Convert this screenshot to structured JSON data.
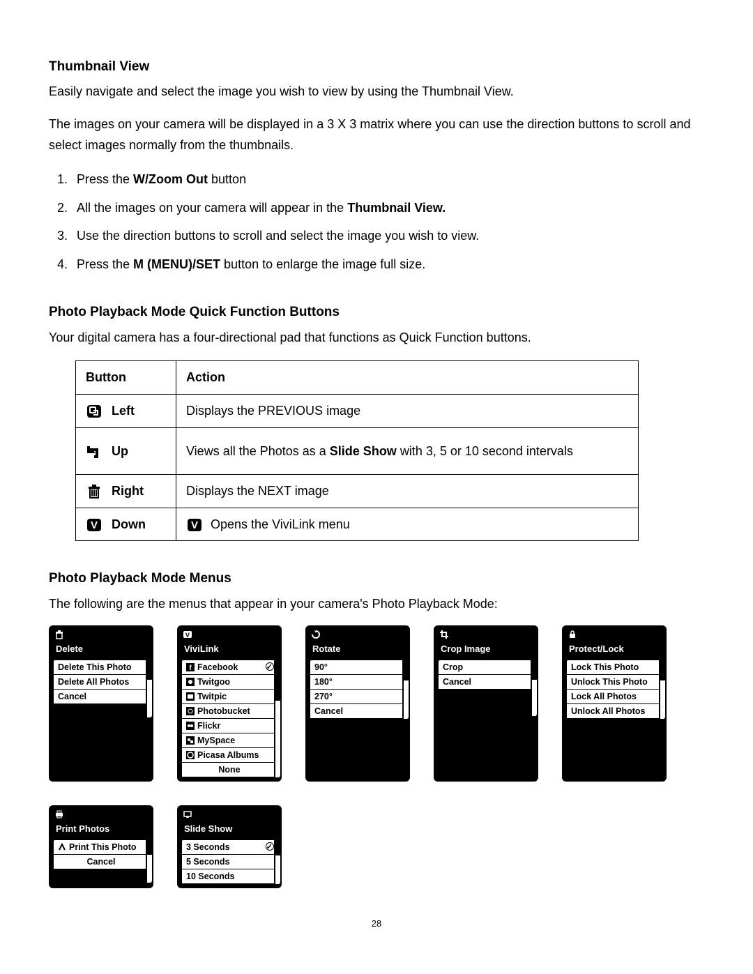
{
  "section1": {
    "heading": "Thumbnail View",
    "p1": "Easily navigate and select the image you wish to view by using the Thumbnail View.",
    "p2": "The images on your camera will be displayed in a 3 X 3 matrix where you can use the direction buttons to scroll and select images normally from the thumbnails."
  },
  "steps": {
    "s1a": "Press the ",
    "s1b": "W/Zoom Out",
    "s1c": " button",
    "s2a": "All the images on your camera will appear in the ",
    "s2b": "Thumbnail View.",
    "s3": "Use the direction buttons to scroll and select the image you wish to view.",
    "s4a": "Press the ",
    "s4b": "M (MENU)/SET",
    "s4c": " button to enlarge the image full size."
  },
  "section2": {
    "heading": "Photo Playback Mode Quick Function Buttons",
    "intro": "Your digital camera has a four-directional pad that functions as Quick Function buttons."
  },
  "table": {
    "h1": "Button",
    "h2": "Action",
    "r1": {
      "btn": "Left",
      "act": "Displays the PREVIOUS image"
    },
    "r2": {
      "btn": "Up",
      "act_a": "Views all the Photos as a ",
      "act_b": "Slide Show",
      "act_c": " with 3, 5 or 10 second intervals"
    },
    "r3": {
      "btn": "Right",
      "act": "Displays the NEXT image"
    },
    "r4": {
      "btn": "Down",
      "act": "Opens the ViviLink menu"
    }
  },
  "section3": {
    "heading": "Photo Playback Mode Menus",
    "intro": "The following are the menus that appear in your camera's Photo Playback Mode:"
  },
  "menus": {
    "delete": {
      "title": "Delete",
      "items": [
        "Delete This Photo",
        "Delete All Photos",
        "Cancel"
      ]
    },
    "vivilink": {
      "title": "ViviLink",
      "items": [
        "Facebook",
        "Twitgoo",
        "Twitpic",
        "Photobucket",
        "Flickr",
        "MySpace",
        "Picasa Albums",
        "None"
      ]
    },
    "rotate": {
      "title": "Rotate",
      "items": [
        "90°",
        "180°",
        "270°",
        "Cancel"
      ]
    },
    "crop": {
      "title": "Crop Image",
      "items": [
        "Crop",
        "Cancel"
      ]
    },
    "protect": {
      "title": "Protect/Lock",
      "items": [
        "Lock This Photo",
        "Unlock This Photo",
        "Lock All Photos",
        "Unlock All Photos"
      ]
    },
    "print": {
      "title": "Print Photos",
      "items": [
        "Print This Photo",
        "Cancel"
      ]
    },
    "slideshow": {
      "title": "Slide Show",
      "items": [
        "3 Seconds",
        "5 Seconds",
        "10 Seconds"
      ]
    }
  },
  "page": "28"
}
